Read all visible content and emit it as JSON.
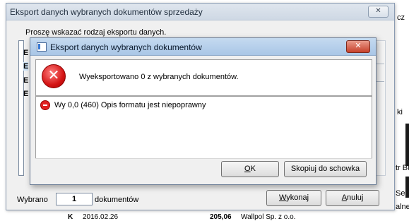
{
  "background": {
    "fragments": [
      "cz",
      "ki",
      "tr Bu",
      "Sego",
      "alne"
    ],
    "bottom_row": {
      "date": "2016.02.26",
      "amount": "205,06",
      "customer": "Wallpol Sp. z o.o."
    }
  },
  "outer_dialog": {
    "title": "Eksport danych wybranych dokumentów sprzedaży",
    "close_glyph": "✕",
    "prompt": "Proszę wskazać rodzaj eksportu danych.",
    "list_letters": [
      "E",
      "E",
      "E",
      "E"
    ],
    "selected_label": "Wybrano",
    "selected_count": "1",
    "selected_suffix": "dokumentów",
    "execute_button": {
      "accel": "W",
      "rest": "ykonaj"
    },
    "cancel_button": {
      "accel": "A",
      "rest": "nuluj"
    }
  },
  "inner_dialog": {
    "title": "Eksport danych wybranych dokumentów",
    "close_glyph": "✕",
    "message": "Wyeksportowano 0 z wybranych dokumentów.",
    "error_icon_glyph": "✕",
    "details": [
      "Wy 0,0 (460) Opis formatu  jest niepoprawny"
    ],
    "ok_button": {
      "accel": "O",
      "rest": "K"
    },
    "copy_button": "Skopiuj do schowka"
  }
}
